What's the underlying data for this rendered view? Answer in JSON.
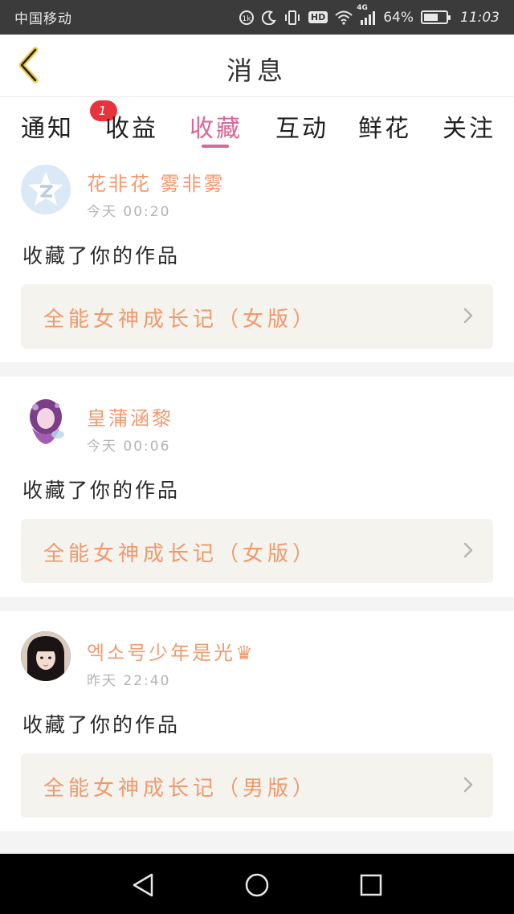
{
  "status_bar": {
    "carrier": "中国移动",
    "network": "4G",
    "battery_text": "64%",
    "battery_level": 0.64,
    "time": "11:03",
    "hd_label": "HD"
  },
  "header": {
    "title": "消息",
    "back_icon": "chevron-left-icon",
    "accent": "#d9679a"
  },
  "tabs": [
    {
      "label": "通知",
      "badge": "1"
    },
    {
      "label": "收益"
    },
    {
      "label": "收藏",
      "active": true
    },
    {
      "label": "互动"
    },
    {
      "label": "鲜花"
    },
    {
      "label": "关注"
    }
  ],
  "messages": [
    {
      "user": "花非花 雾非雾",
      "time": "今天  00:20",
      "action": "收藏了你的作品",
      "work": "全能女神成长记（女版）"
    },
    {
      "user": "皇蒲涵黎",
      "time": "今天  00:06",
      "action": "收藏了你的作品",
      "work": "全能女神成长记（女版）"
    },
    {
      "user": "엑소号少年是光♛",
      "time": "昨天  22:40",
      "action": "收藏了你的作品",
      "work": "全能女神成长记（男版）"
    }
  ],
  "colors": {
    "username": "#ef9a6e",
    "badge": "#e8323c",
    "work_box_bg": "#f4f3ed"
  }
}
